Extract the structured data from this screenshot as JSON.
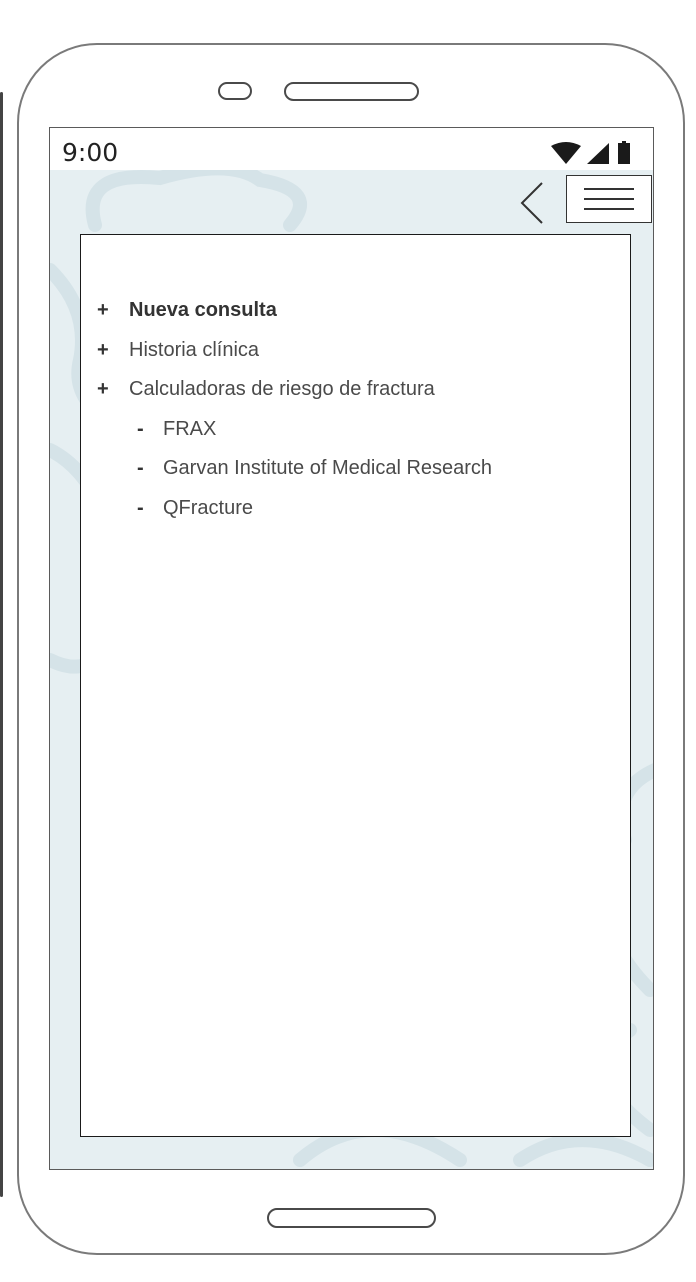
{
  "status_bar": {
    "time": "9:00",
    "icons": [
      "wifi-icon",
      "signal-icon",
      "battery-icon"
    ]
  },
  "top_bar": {
    "back_icon": "chevron-left-icon",
    "menu_icon": "hamburger-menu-icon"
  },
  "menu": {
    "items": [
      {
        "bullet": "+",
        "label": "Nueva consulta",
        "bold": true
      },
      {
        "bullet": "+",
        "label": "Historia clínica",
        "bold": false
      },
      {
        "bullet": "+",
        "label": "Calculadoras de riesgo de fractura",
        "bold": false,
        "children": [
          {
            "bullet": "-",
            "label": "FRAX"
          },
          {
            "bullet": "-",
            "label": "Garvan Institute of Medical Research"
          },
          {
            "bullet": "-",
            "label": "QFracture"
          }
        ]
      }
    ]
  },
  "colors": {
    "screen_background": "#e6eff2",
    "panel_background": "#ffffff",
    "text": "#4a4a4a",
    "frame": "#7a7a7a"
  }
}
